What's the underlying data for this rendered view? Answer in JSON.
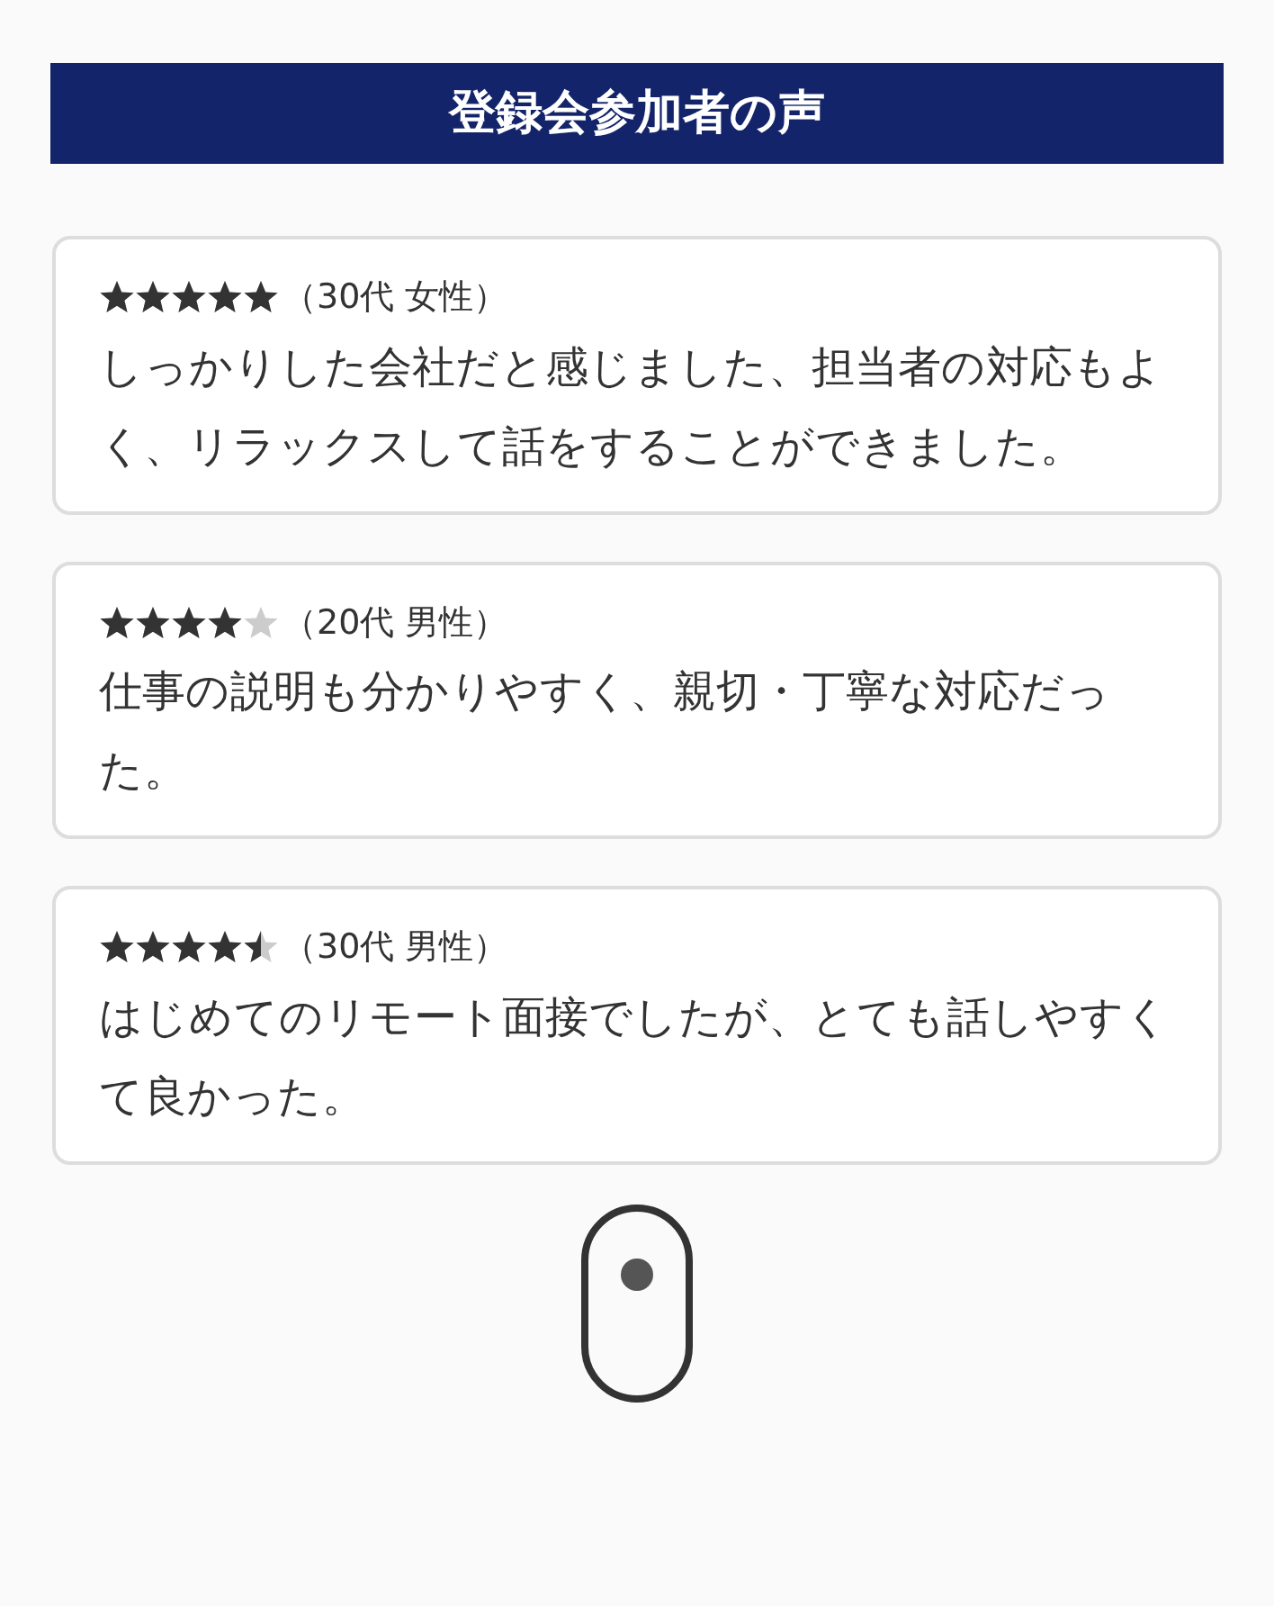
{
  "heading": "登録会参加者の声",
  "reviews": [
    {
      "stars": 5,
      "meta": "（30代 女性）",
      "text": "しっかりした会社だと感じました、担当者の対応もよく、リラックスして話をすることができました。"
    },
    {
      "stars": 4,
      "meta": "（20代 男性）",
      "text": "仕事の説明も分かりやすく、親切・丁寧な対応だった。"
    },
    {
      "stars": 4.5,
      "meta": "（30代 男性）",
      "text": "はじめてのリモート面接でしたが、とても話しやすくて良かった。"
    }
  ]
}
